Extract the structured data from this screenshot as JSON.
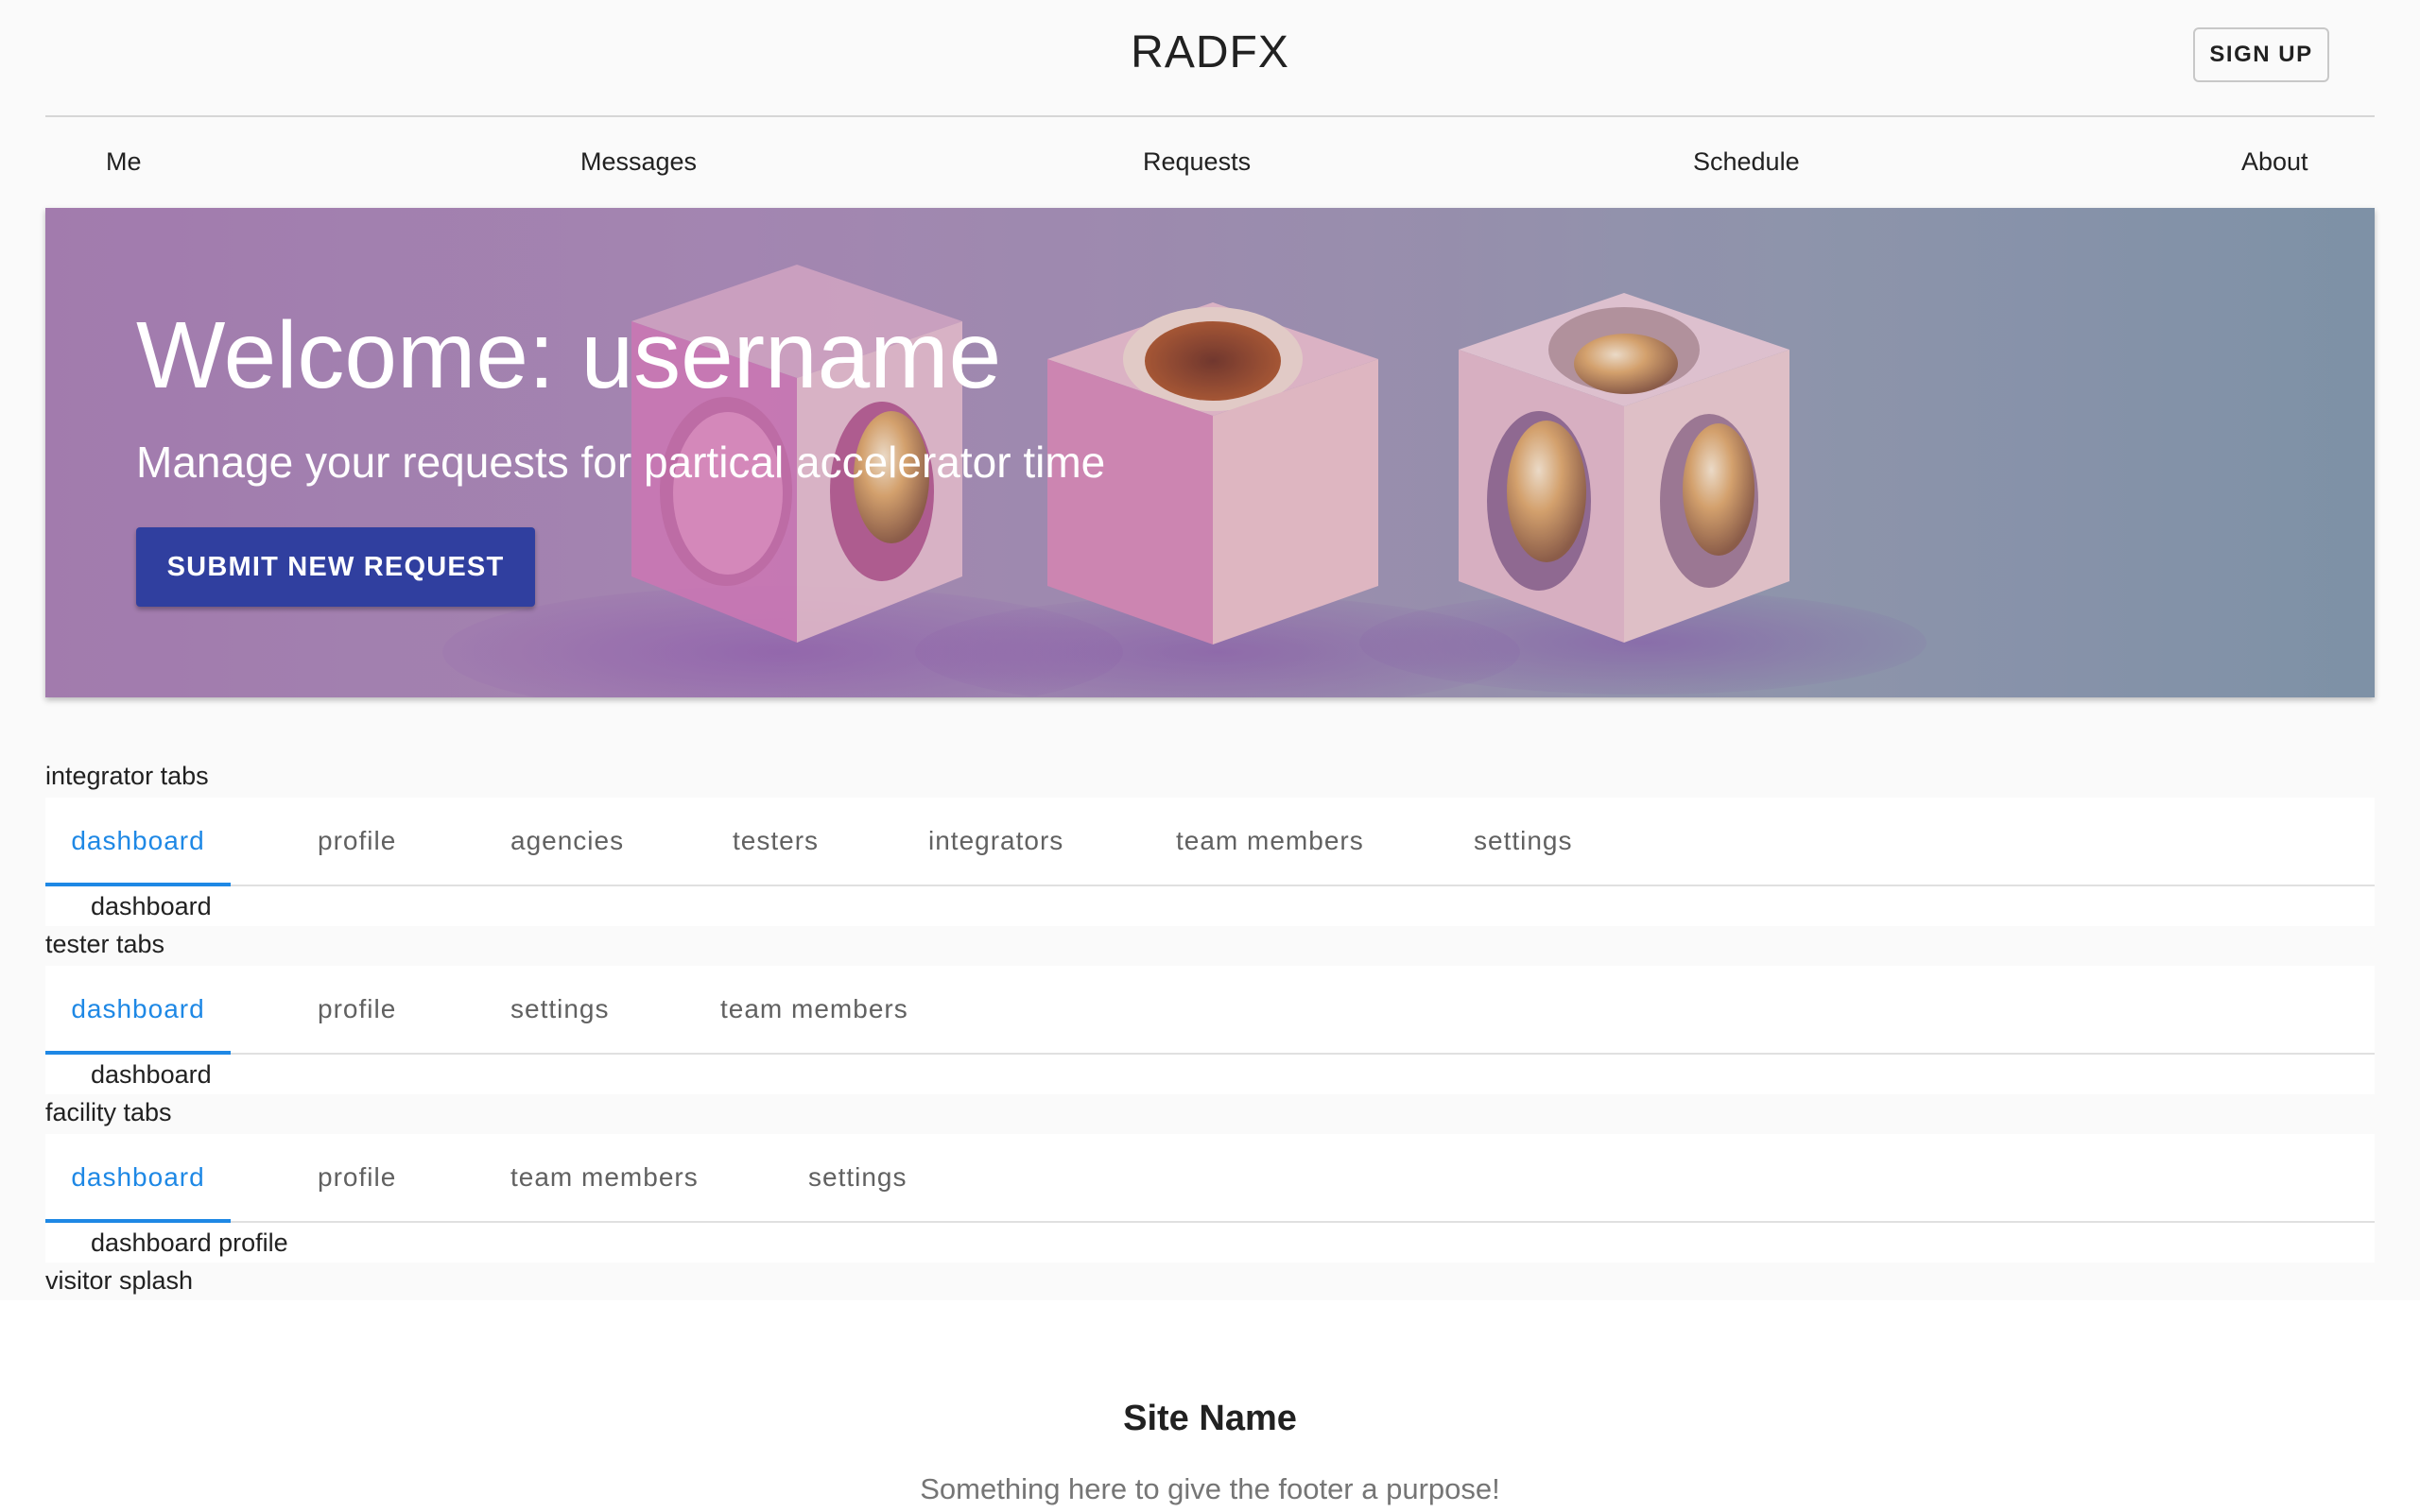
{
  "header": {
    "title": "RADFX",
    "signup_label": "SIGN UP"
  },
  "nav": {
    "items": [
      {
        "label": "Me"
      },
      {
        "label": "Messages"
      },
      {
        "label": "Requests"
      },
      {
        "label": "Schedule"
      },
      {
        "label": "About"
      }
    ]
  },
  "hero": {
    "title": "Welcome: username",
    "subtitle": "Manage your requests for partical accelerator time",
    "button_label": "SUBMIT NEW REQUEST",
    "image_alt_icon": "cubes-with-spheres-illustration"
  },
  "sections": {
    "integrator": {
      "label": "integrator tabs",
      "tabs": [
        "dashboard",
        "profile",
        "agencies",
        "testers",
        "integrators",
        "team members",
        "settings"
      ],
      "active_tab": "dashboard",
      "content": "dashboard"
    },
    "tester": {
      "label": "tester tabs",
      "tabs": [
        "dashboard",
        "profile",
        "settings",
        "team members"
      ],
      "active_tab": "dashboard",
      "content": "dashboard"
    },
    "facility": {
      "label": "facility tabs",
      "tabs": [
        "dashboard",
        "profile",
        "team members",
        "settings"
      ],
      "active_tab": "dashboard",
      "content": "dashboard profile"
    },
    "visitor": {
      "label": "visitor splash"
    }
  },
  "footer": {
    "title": "Site Name",
    "subtitle": "Something here to give the footer a purpose!"
  },
  "colors": {
    "primary_button": "#303f9f",
    "active_tab": "#1e88e5",
    "footer_text": "#757575"
  }
}
